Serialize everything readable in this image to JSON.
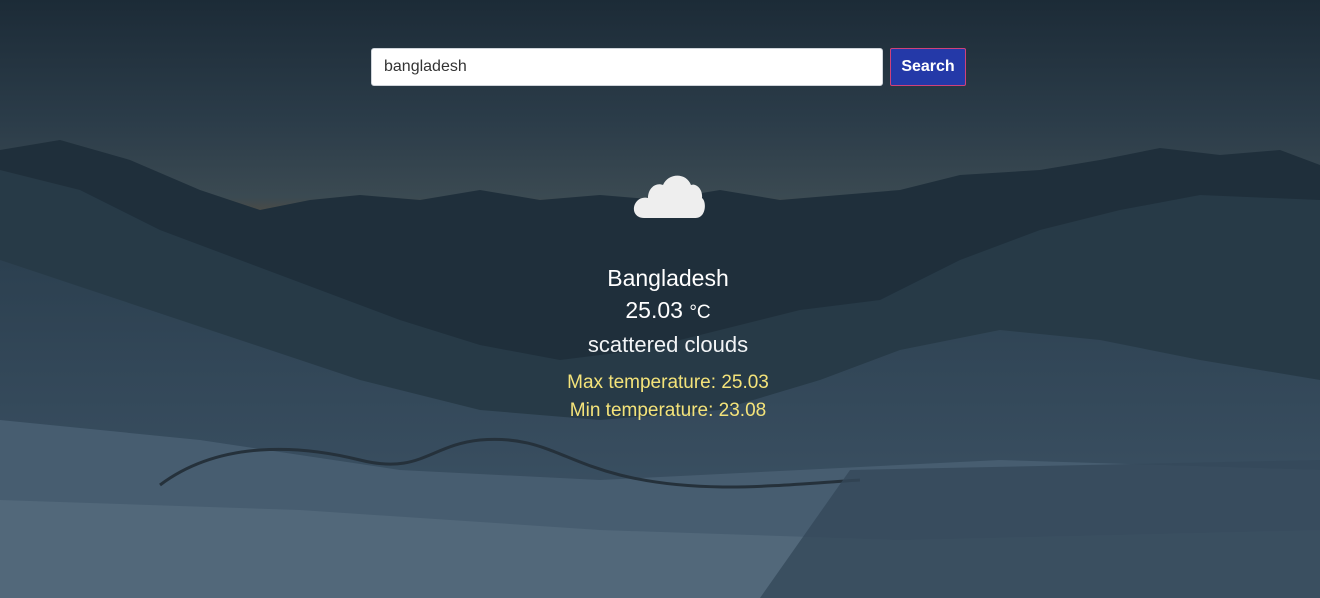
{
  "search": {
    "value": "bangladesh",
    "button_label": "Search"
  },
  "weather": {
    "icon": "cloud-icon",
    "city": "Bangladesh",
    "temperature": "25.03",
    "unit": "°C",
    "description": "scattered clouds",
    "max_label": "Max temperature: ",
    "max_value": "25.03",
    "min_label": "Min temperature: ",
    "min_value": "23.08"
  },
  "colors": {
    "button_bg": "#2439a8",
    "button_border": "#d0417a",
    "range_text": "#f4e37a"
  }
}
